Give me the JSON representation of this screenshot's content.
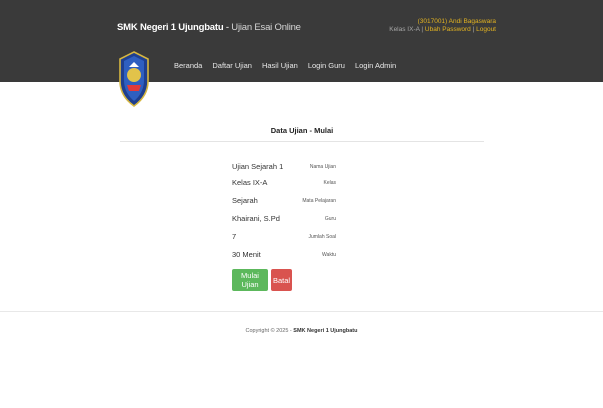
{
  "header": {
    "brand_bold": "SMK Negeri 1 Ujungbatu",
    "brand_separator": " - ",
    "brand_sub": "Ujian Esai Online",
    "user_line": "(3017001) Andi Bagaswara",
    "kelas_prefix": "Kelas IX-A",
    "kelas_open": " | ",
    "change_password": "Ubah Password",
    "kelas_mid": " | ",
    "logout": "Logout"
  },
  "nav": {
    "items": [
      "Beranda",
      "Daftar Ujian",
      "Hasil Ujian",
      "Login Guru",
      "Login Admin"
    ]
  },
  "panel": {
    "title": "Data Ujian - Mulai",
    "fields": [
      {
        "label": "Nama Ujian",
        "value": "Ujian Sejarah 1"
      },
      {
        "label": "Kelas",
        "value": "Kelas IX-A"
      },
      {
        "label": "Mata Pelajaran",
        "value": "Sejarah"
      },
      {
        "label": "Guru",
        "value": "Khairani, S.Pd"
      },
      {
        "label": "Jumlah Soal",
        "value": "7"
      },
      {
        "label": "Waktu",
        "value": "30 Menit"
      }
    ],
    "start_button": "Mulai Ujian",
    "cancel_button": "Batal"
  },
  "footer": {
    "prefix": "Copyright © 2025 - ",
    "org": "SMK Negeri 1 Ujungbatu"
  },
  "colors": {
    "topbar": "#3a3a3a",
    "start_button": "#5cb85c",
    "cancel_button": "#d9534f",
    "user_highlight": "#e3b320",
    "user_id": "#3aa0e0"
  }
}
